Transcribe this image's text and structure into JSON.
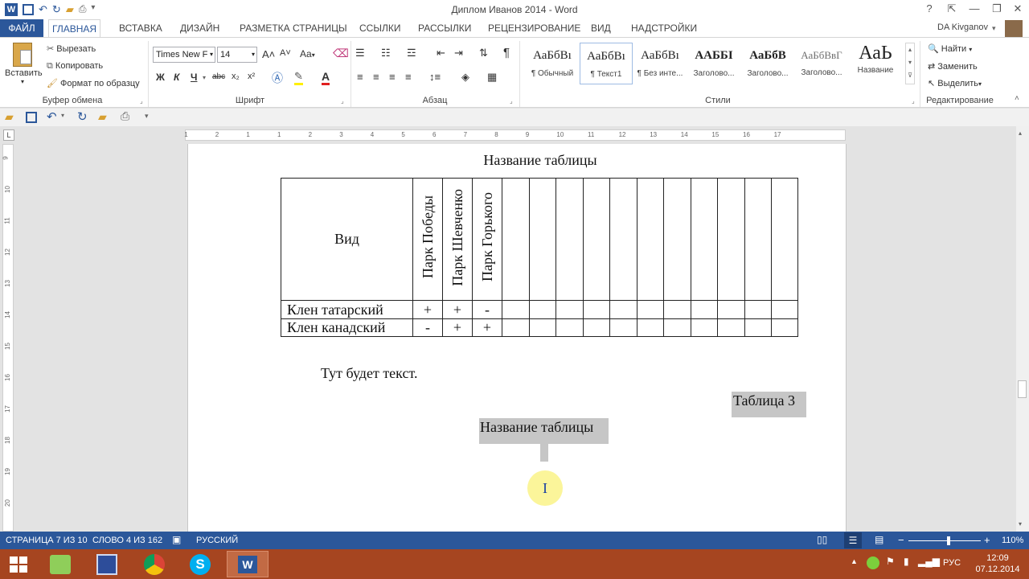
{
  "window": {
    "title": "Диплом Иванов 2014 - Word",
    "help": "?",
    "minimize": "—",
    "restore": "❐",
    "close": "✕"
  },
  "tabs": [
    "ФАЙЛ",
    "ГЛАВНАЯ",
    "ВСТАВКА",
    "ДИЗАЙН",
    "РАЗМЕТКА СТРАНИЦЫ",
    "ССЫЛКИ",
    "РАССЫЛКИ",
    "РЕЦЕНЗИРОВАНИЕ",
    "ВИД",
    "НАДСТРОЙКИ"
  ],
  "user": {
    "name": "DA Kivganov"
  },
  "clipboard": {
    "paste": "Вставить",
    "cut": "Вырезать",
    "copy": "Копировать",
    "format_painter": "Формат по образцу",
    "group": "Буфер обмена"
  },
  "font": {
    "name": "Times New F",
    "size": "14",
    "bold": "Ж",
    "italic": "К",
    "underline": "Ч",
    "strike": "abc",
    "sub": "x₂",
    "sup": "x²",
    "grow": "A˄",
    "shrink": "A˅",
    "case": "Aa",
    "color_a": "A",
    "group": "Шрифт"
  },
  "paragraph": {
    "group": "Абзац",
    "pilcrow": "¶"
  },
  "styles": {
    "group": "Стили",
    "items": [
      {
        "sample": "АаБбВı",
        "name": "¶ Обычный"
      },
      {
        "sample": "АаБбВı",
        "name": "¶ Текст1"
      },
      {
        "sample": "АаБбВı",
        "name": "¶ Без инте..."
      },
      {
        "sample": "ААББІ",
        "name": "Заголово..."
      },
      {
        "sample": "АаБбВ",
        "name": "Заголово..."
      },
      {
        "sample": "АаБбВвГ",
        "name": "Заголово..."
      },
      {
        "sample": "АаЬ",
        "name": "Название"
      }
    ]
  },
  "editing": {
    "find": "Найти",
    "replace": "Заменить",
    "select": "Выделить",
    "group": "Редактирование"
  },
  "ruler": {
    "h_ticks": [
      "3",
      "1",
      "2",
      "1",
      "1",
      "2",
      "3",
      "4",
      "5",
      "6",
      "7",
      "8",
      "9",
      "10",
      "11",
      "12",
      "13",
      "14",
      "15",
      "16",
      "17"
    ],
    "v_ticks": [
      "9",
      "10",
      "11",
      "12",
      "13",
      "14",
      "15",
      "16",
      "17",
      "18",
      "19",
      "20"
    ]
  },
  "document": {
    "caption_top": "Название таблицы",
    "table": {
      "header_first": "Вид",
      "header_cols": [
        "Парк Победы",
        "Парк Шевченко",
        "Парк Горького"
      ],
      "empty_cols": 11,
      "rows": [
        {
          "name": "Клен татарский",
          "values": [
            "+",
            "+",
            "-"
          ]
        },
        {
          "name": "Клен канадский",
          "values": [
            "-",
            "+",
            "+"
          ]
        }
      ]
    },
    "body_text": "Тут будет текст.",
    "table_label": "Таблица 3",
    "caption_selected": "Название таблицы"
  },
  "status": {
    "page": "СТРАНИЦА 7 ИЗ 10",
    "words": "СЛОВО 4 ИЗ 162",
    "language": "РУССКИЙ",
    "zoom": "110%",
    "zoom_minus": "−",
    "zoom_plus": "+",
    "zoom_level": 0.55
  },
  "taskbar": {
    "lang": "РУС",
    "time": "12:09",
    "date": "07.12.2014"
  },
  "colors": {
    "accent": "#2b579a",
    "taskbar": "#a64520",
    "selection": "#c6c6c6"
  }
}
